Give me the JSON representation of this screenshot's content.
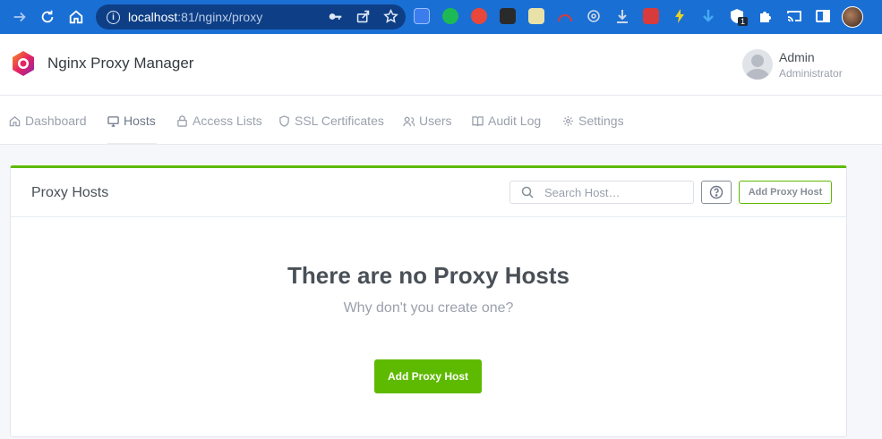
{
  "browser": {
    "url_host": "localhost",
    "url_path": ":81/nginx/proxy",
    "extension_badge": "1"
  },
  "app": {
    "title": "Nginx Proxy Manager"
  },
  "user": {
    "name": "Admin",
    "role": "Administrator"
  },
  "nav": {
    "items": [
      {
        "label": "Dashboard",
        "icon": "home-icon"
      },
      {
        "label": "Hosts",
        "icon": "monitor-icon"
      },
      {
        "label": "Access Lists",
        "icon": "lock-icon"
      },
      {
        "label": "SSL Certificates",
        "icon": "shield-icon"
      },
      {
        "label": "Users",
        "icon": "users-icon"
      },
      {
        "label": "Audit Log",
        "icon": "book-icon"
      },
      {
        "label": "Settings",
        "icon": "gear-icon"
      }
    ],
    "active": "Hosts"
  },
  "card": {
    "title": "Proxy Hosts",
    "search_placeholder": "Search Host…",
    "add_button": "Add Proxy Host",
    "empty_title": "There are no Proxy Hosts",
    "empty_subtitle": "Why don't you create one?",
    "empty_add_button": "Add Proxy Host"
  },
  "colors": {
    "browser_bar": "#1a6fd4",
    "accent_green": "#5eba00",
    "text_muted": "#9aa0ac"
  }
}
